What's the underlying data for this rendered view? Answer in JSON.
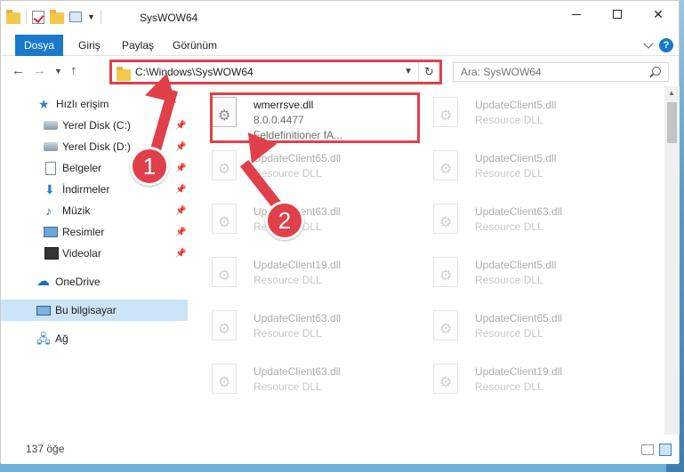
{
  "window": {
    "title": "SysWOW64",
    "minimize_label": "",
    "maximize_label": "",
    "close_label": "✕"
  },
  "ribbon": {
    "tabs": [
      {
        "label": "Dosya"
      },
      {
        "label": "Giriş"
      },
      {
        "label": "Paylaş"
      },
      {
        "label": "Görünüm"
      }
    ]
  },
  "address_bar": {
    "path": "C:\\Windows\\SysWOW64"
  },
  "search": {
    "placeholder": "Ara: SysWOW64"
  },
  "navigation": {
    "items": [
      {
        "label": "Hızlı erişim",
        "icon": "star-icon"
      },
      {
        "label": "Yerel Disk (C:)",
        "icon": "disk-icon",
        "pinned": true
      },
      {
        "label": "Yerel Disk (D:)",
        "icon": "disk-icon",
        "pinned": true
      },
      {
        "label": "Belgeler",
        "icon": "document-icon",
        "pinned": true
      },
      {
        "label": "İndirmeler",
        "icon": "download-icon",
        "pinned": true
      },
      {
        "label": "Müzik",
        "icon": "music-icon",
        "pinned": true
      },
      {
        "label": "Resimler",
        "icon": "pictures-icon",
        "pinned": true
      },
      {
        "label": "Videolar",
        "icon": "video-icon",
        "pinned": true
      },
      {
        "label": "OneDrive",
        "icon": "cloud-icon"
      },
      {
        "label": "Bu bilgisayar",
        "icon": "computer-icon",
        "selected": true
      },
      {
        "label": "Ağ",
        "icon": "network-icon"
      }
    ]
  },
  "files": [
    {
      "name": "wmerrsve.dll",
      "version": "8.0.0.4477",
      "description": "Feldefinitioner fA...",
      "highlighted": true
    },
    {
      "name": "UpdateClient5.dll",
      "description": "Resource DLL"
    },
    {
      "name": "UpdateClient65.dll",
      "description": "Resource DLL"
    },
    {
      "name": "UpdateClient5.dll",
      "description": "Resource DLL"
    },
    {
      "name": "UpdateClient63.dll",
      "description": "Resource DLL"
    },
    {
      "name": "UpdateClient63.dll",
      "description": "Resource DLL"
    },
    {
      "name": "UpdateClient19.dll",
      "description": "Resource DLL"
    },
    {
      "name": "UpdateClient5.dll",
      "description": "Resource DLL"
    },
    {
      "name": "UpdateClient63.dll",
      "description": "Resource DLL"
    },
    {
      "name": "UpdateClient65.dll",
      "description": "Resource DLL"
    },
    {
      "name": "UpdateClient63.dll",
      "description": "Resource DLL"
    },
    {
      "name": "UpdateClient19.dll",
      "description": "Resource DLL"
    }
  ],
  "status_bar": {
    "item_count": "137 öğe"
  },
  "annotations": {
    "step1": "1",
    "step2": "2",
    "color": "#e0404a"
  }
}
